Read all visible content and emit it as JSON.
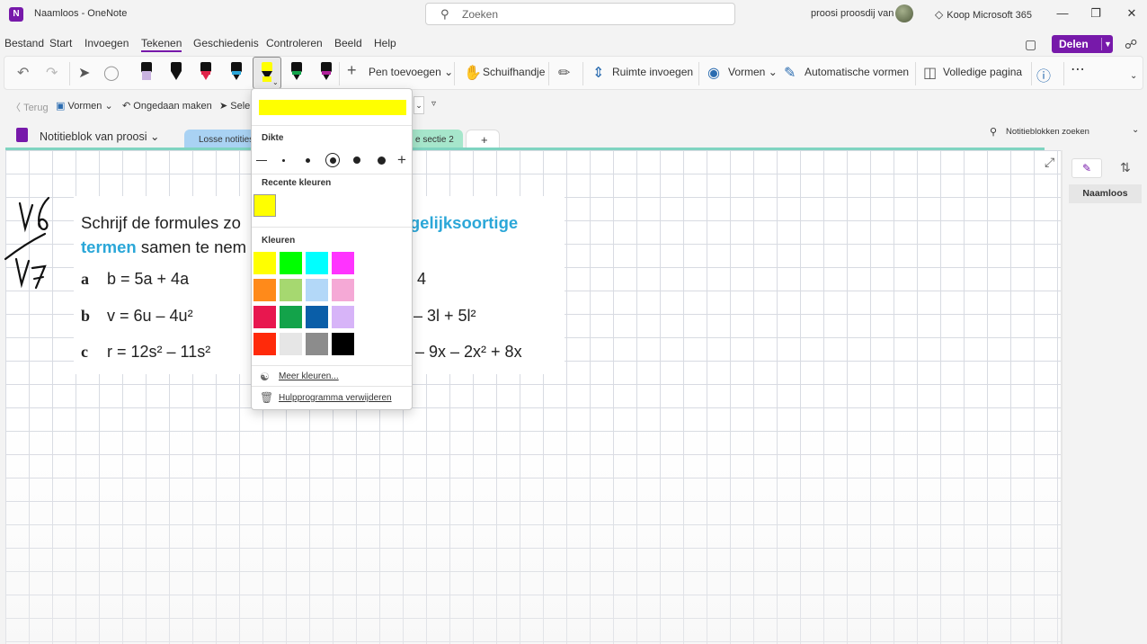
{
  "window": {
    "app_logo": "N",
    "title": "Naamloos  -  OneNote",
    "search_placeholder": "Zoeken",
    "user": "proosi proosdij van",
    "buy_label": "Koop Microsoft 365"
  },
  "menu": {
    "items": [
      "Bestand",
      "Start",
      "Invoegen",
      "Tekenen",
      "Geschiedenis",
      "Controleren",
      "Beeld",
      "Help"
    ],
    "active": "Tekenen",
    "share_label": "Delen"
  },
  "ribbon": {
    "add_pen": "Pen toevoegen",
    "hand": "Schuifhandje",
    "insert_space": "Ruimte invoegen",
    "shapes": "Vormen",
    "auto_shapes": "Automatische vormen",
    "full_page": "Volledige pagina",
    "more": "⋯"
  },
  "pens": [
    {
      "color": "#c9b3e0"
    },
    {
      "color": "#111111"
    },
    {
      "color": "#e0244a"
    },
    {
      "color": "#2aa5d8"
    },
    {
      "color": "#ffff00"
    },
    {
      "color": "#13a34a"
    },
    {
      "color": "#b0209a"
    }
  ],
  "subtoolbar": {
    "back": "Terug",
    "shapes": "Vormen",
    "undo": "Ongedaan maken",
    "select": "Sele"
  },
  "notebook": {
    "name": "Notitieblok van proosi",
    "tabs": [
      "Losse notities",
      "e sectie 2",
      "+"
    ],
    "search_placeholder": "Notitieblokken zoeken"
  },
  "page_content": {
    "title_part1": "Schrijf de formules zo",
    "title_hl1": "gelijksoortige",
    "title_hl2": "termen",
    "title_part2": " samen te nem",
    "rows": [
      {
        "label": "a",
        "left": "b = 5a + 4a",
        "right": "4"
      },
      {
        "label": "b",
        "left": "v = 6u – 4u²",
        "right": "– 3l + 5l²"
      },
      {
        "label": "c",
        "left": "r = 12s² – 11s²",
        "right": "– 9x – 2x² + 8x"
      }
    ],
    "handwriting_top": "V6",
    "handwriting_bottom": "V7"
  },
  "right_pane": {
    "page_title": "Naamloos"
  },
  "color_dropdown": {
    "current_color": "#ffff00",
    "thickness_label": "Dikte",
    "recent_label": "Recente kleuren",
    "recent_colors": [
      "#ffff00"
    ],
    "colors_label": "Kleuren",
    "colors": [
      "#ffff00",
      "#00ff00",
      "#00ffff",
      "#ff33ff",
      "#ff8a1a",
      "#a6d870",
      "#b3d8f8",
      "#f5a9d6",
      "#e8174f",
      "#13a34a",
      "#0a5ea8",
      "#d7b4f8",
      "#ff2a0a",
      "#e6e6e6",
      "#8c8c8c",
      "#000000"
    ],
    "more_colors": "Meer kleuren...",
    "remove_tool": "Hulpprogramma verwijderen"
  }
}
